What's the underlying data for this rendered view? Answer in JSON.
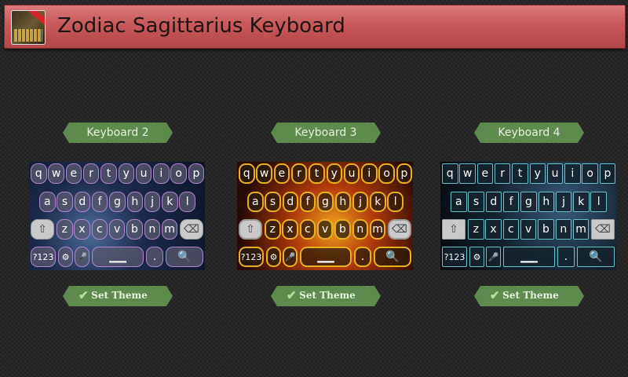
{
  "app": {
    "title": "Zodiac Sagittarius Keyboard",
    "icon": "app-icon"
  },
  "colors": {
    "titlebar": "#c8585b",
    "label_pill": "#5e8a4e",
    "background": "#232323"
  },
  "keyboards": [
    {
      "label": "Keyboard 2",
      "button_label": "Set Theme",
      "row1": [
        "q",
        "w",
        "e",
        "r",
        "t",
        "y",
        "u",
        "i",
        "o",
        "p"
      ],
      "row2": [
        "a",
        "s",
        "d",
        "f",
        "g",
        "h",
        "j",
        "k",
        "l"
      ],
      "row3": [
        "z",
        "x",
        "c",
        "v",
        "b",
        "n",
        "m"
      ],
      "numbers_label": "?123",
      "period_label": "."
    },
    {
      "label": "Keyboard 3",
      "button_label": "Set Theme",
      "row1": [
        "q",
        "w",
        "e",
        "r",
        "t",
        "y",
        "u",
        "i",
        "o",
        "p"
      ],
      "row2": [
        "a",
        "s",
        "d",
        "f",
        "g",
        "h",
        "j",
        "k",
        "l"
      ],
      "row3": [
        "z",
        "x",
        "c",
        "v",
        "b",
        "n",
        "m"
      ],
      "numbers_label": "?123",
      "period_label": "."
    },
    {
      "label": "Keyboard 4",
      "button_label": "Set Theme",
      "row1": [
        "q",
        "w",
        "e",
        "r",
        "t",
        "y",
        "u",
        "i",
        "o",
        "p"
      ],
      "row2": [
        "a",
        "s",
        "d",
        "f",
        "g",
        "h",
        "j",
        "k",
        "l"
      ],
      "row3": [
        "z",
        "x",
        "c",
        "v",
        "b",
        "n",
        "m"
      ],
      "numbers_label": "?123",
      "period_label": "."
    }
  ]
}
